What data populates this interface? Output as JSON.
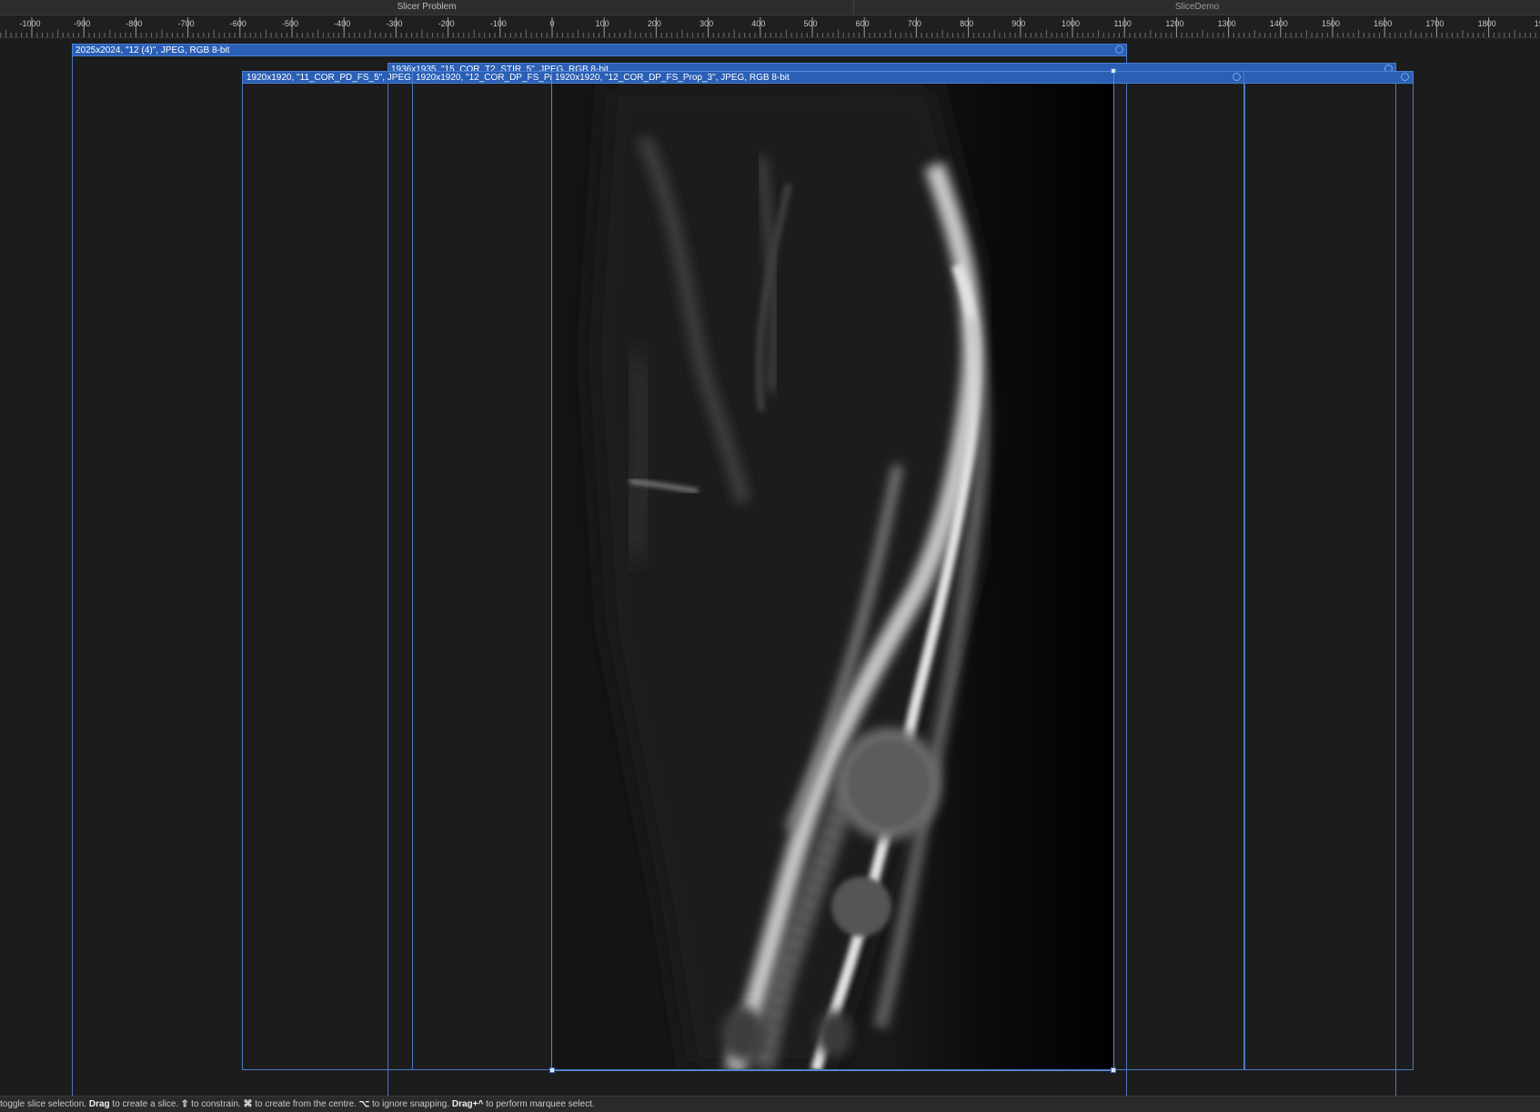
{
  "tabs": [
    {
      "label": "Slicer Problem",
      "active": true
    },
    {
      "label": "SliceDemo",
      "active": false
    }
  ],
  "ruler": {
    "unit": "px",
    "labels": [
      "-1000",
      "-900",
      "-800",
      "-700",
      "-600",
      "-500",
      "-400",
      "-300",
      "-200",
      "-100",
      "0",
      "100",
      "200",
      "300",
      "400",
      "500",
      "600",
      "700",
      "800",
      "900",
      "1000",
      "1100",
      "1200",
      "1300",
      "1400",
      "1500",
      "1600",
      "1700",
      "1800",
      "19"
    ]
  },
  "slices": [
    {
      "label": "2025x2024, \"12 (4)\", JPEG, RGB 8-bit"
    },
    {
      "label": "1936x1935, \"15_COR_T2_STIR_5\", JPEG, RGB 8-bit"
    },
    {
      "label": "1920x1920, \"11_COR_PD_FS_5\", JPEG, RGB 8-bit"
    },
    {
      "label": "1920x1920, \"12_COR_DP_FS_Prop_5\", JPEG, RGB 8-bit"
    },
    {
      "label": "1920x1920, \"12_COR_DP_FS_Prop_3\", JPEG, RGB 8-bit"
    }
  ],
  "canvas_image": {
    "description_icon": "mri-scan-image"
  },
  "status": {
    "t1": "toggle slice selection. ",
    "k1": "Drag",
    "t2": " to create a slice. ",
    "k2": "⇧",
    "t3": " to constrain. ",
    "k3": "⌘",
    "t4": " to create from the centre. ",
    "k4": "⌥",
    "t5": " to ignore snapping. ",
    "k5": "Drag+^",
    "t6": " to perform marquee select."
  },
  "colors": {
    "slice_accent": "#2a5fb5",
    "slice_border": "#4a79c6"
  }
}
